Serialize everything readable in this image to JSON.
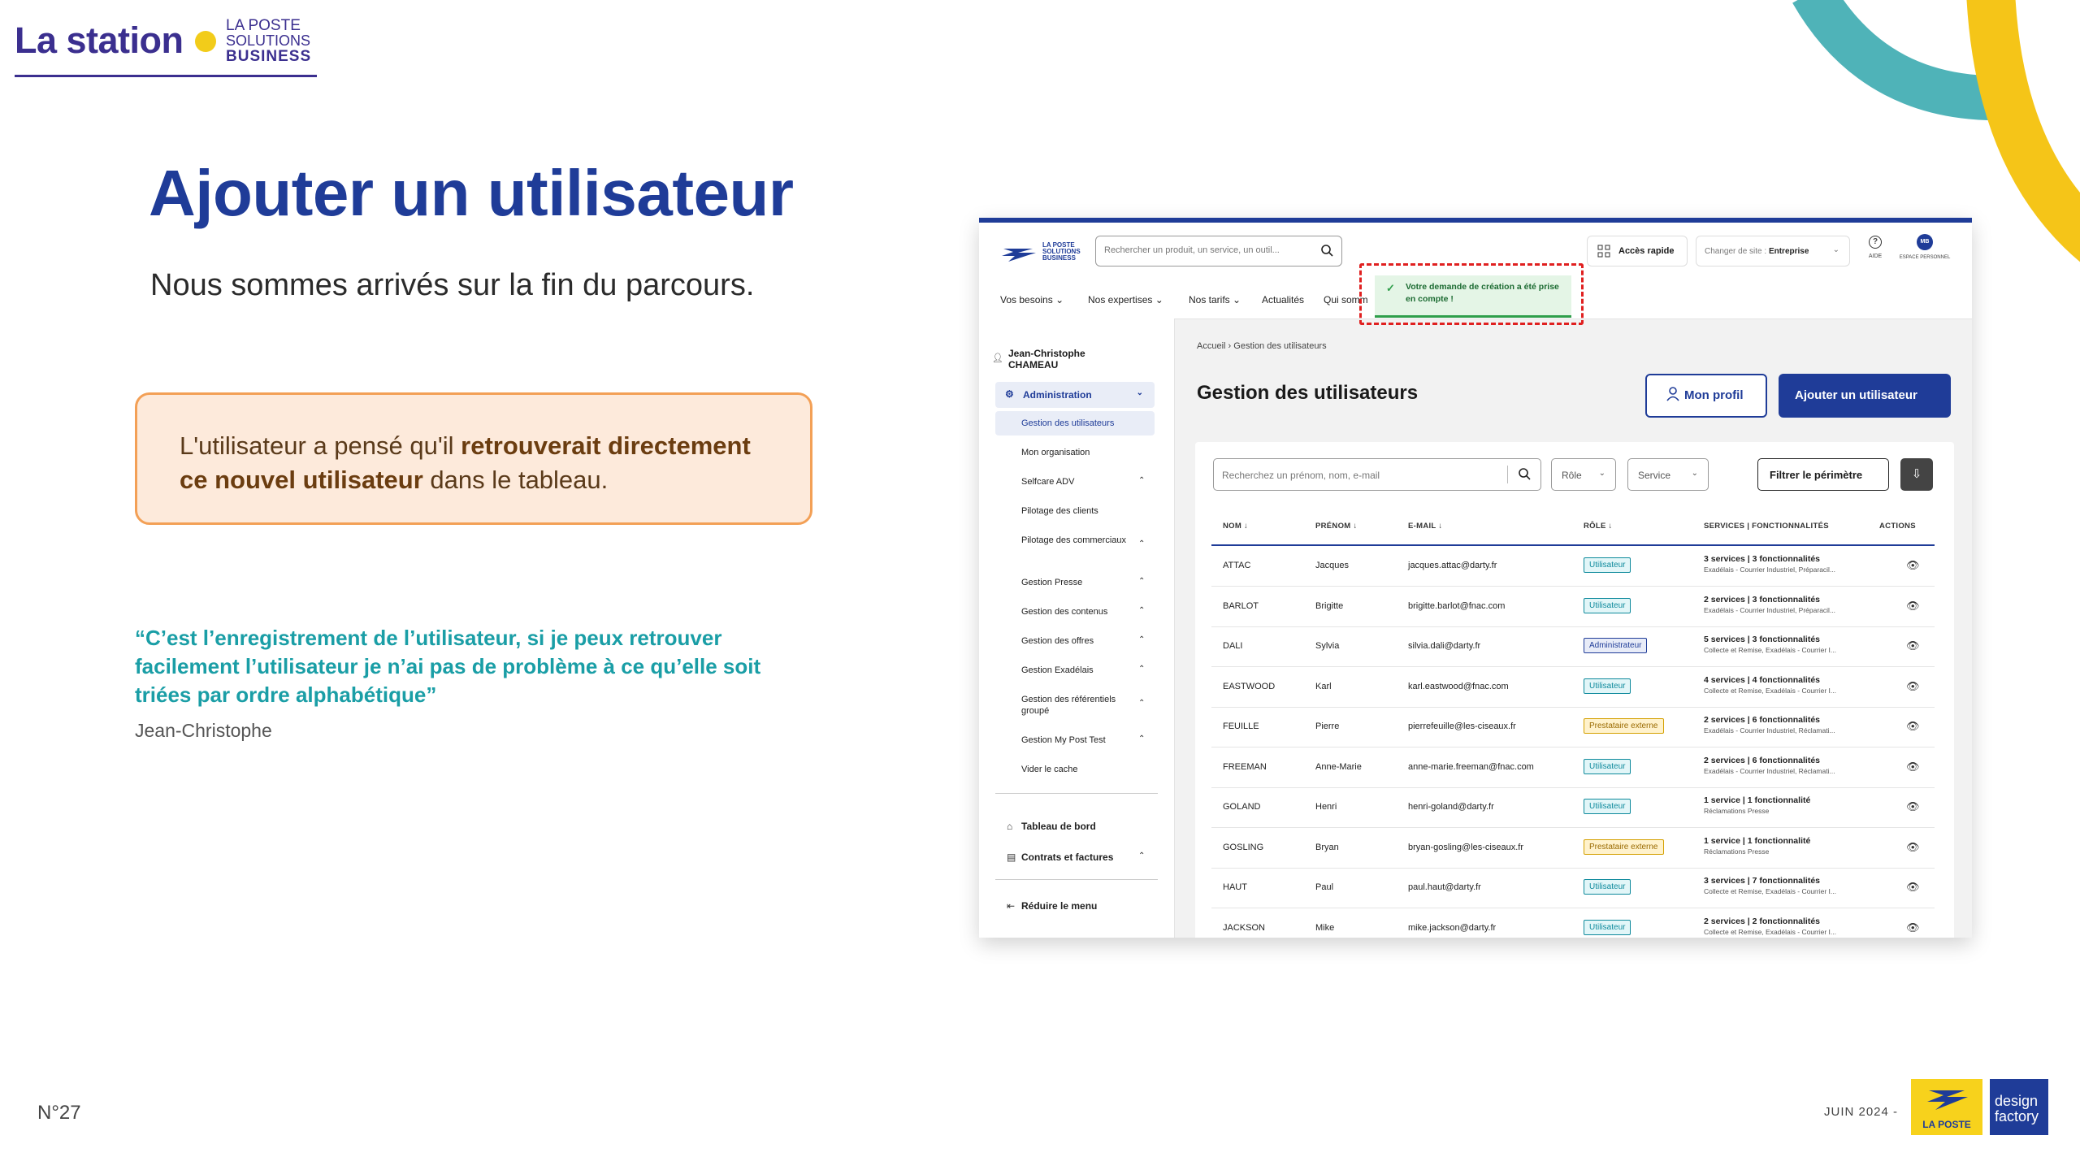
{
  "slide": {
    "brand_name": "La station",
    "brand_sub": [
      "LA POSTE",
      "SOLUTIONS",
      "BUSINESS"
    ],
    "title": "Ajouter un utilisateur",
    "subtitle": "Nous sommes arrivés sur la fin du parcours.",
    "callout": {
      "pre": "L'utilisateur a pensé qu'il ",
      "bold": "retrouverait directement ce nouvel utilisateur",
      "post": " dans le tableau."
    },
    "quote": "“C’est l’enregistrement de l’utilisateur, si je peux retrouver facilement l’utilisateur je n’ai pas de problème à ce qu’elle soit triées par ordre alphabétique”",
    "quote_author": "Jean-Christophe",
    "page_number": "N°27",
    "date": "JUIN 2024 -",
    "logo_laposte": "LA POSTE",
    "logo_df": [
      "design",
      "factory"
    ],
    "colors": {
      "primary": "#1f3c98",
      "accent_yellow": "#f2cc1a",
      "teal": "#1a9ea6",
      "callout_border": "#f3a056"
    }
  },
  "app": {
    "logo_text": [
      "LA POSTE",
      "SOLUTIONS",
      "BUSINESS"
    ],
    "search_placeholder": "Rechercher un produit, un service, un outil...",
    "quick_access": "Accès rapide",
    "site_label": "Changer de site : ",
    "site_value": "Entreprise",
    "help_label": "AIDE",
    "avatar_initials": "MB",
    "profile_label": "ESPACE PERSONNEL",
    "nav": [
      "Vos besoins",
      "Nos expertises",
      "Nos tarifs",
      "Actualités",
      "Qui somm"
    ],
    "toast": "Votre demande de création a été prise en compte !",
    "sidebar": {
      "user": [
        "Jean-Christophe",
        "CHAMEAU"
      ],
      "admin": "Administration",
      "items": [
        "Gestion des utilisateurs",
        "Mon organisation",
        "Selfcare ADV",
        "Pilotage des clients",
        "Pilotage des commerciaux",
        "Gestion Presse",
        "Gestion des contenus",
        "Gestion des offres",
        "Gestion Exadélais",
        "Gestion des référentiels groupé",
        "Gestion My Post Test",
        "Vider le cache"
      ],
      "dashboard": "Tableau de bord",
      "contracts": "Contrats et factures",
      "collapse": "Réduire le menu"
    },
    "breadcrumb": [
      "Accueil",
      "Gestion des utilisateurs"
    ],
    "page_title": "Gestion des utilisateurs",
    "btn_profile": "Mon profil",
    "btn_add": "Ajouter un utilisateur",
    "table_search_placeholder": "Recherchez un prénom, nom, e-mail",
    "filter_role": "Rôle",
    "filter_service": "Service",
    "filter_scope": "Filtrer le périmètre",
    "columns": [
      "NOM",
      "PRÉNOM",
      "E-MAIL",
      "RÔLE",
      "SERVICES | FONCTIONNALITÉS",
      "ACTIONS"
    ],
    "rows": [
      {
        "nom": "ATTAC",
        "prenom": "Jacques",
        "email": "jacques.attac@darty.fr",
        "role": "Utilisateur",
        "role_type": "user",
        "services": "3 services | 3 fonctionnalités",
        "detail": "Exadélais - Courrier Industriel, Préparacil..."
      },
      {
        "nom": "BARLOT",
        "prenom": "Brigitte",
        "email": "brigitte.barlot@fnac.com",
        "role": "Utilisateur",
        "role_type": "user",
        "services": "2 services | 3 fonctionnalités",
        "detail": "Exadélais - Courrier Industriel, Préparacil..."
      },
      {
        "nom": "DALI",
        "prenom": "Sylvia",
        "email": "silvia.dali@darty.fr",
        "role": "Administrateur",
        "role_type": "admin",
        "services": "5 services | 3 fonctionnalités",
        "detail": "Collecte et Remise, Exadélais - Courrier I..."
      },
      {
        "nom": "EASTWOOD",
        "prenom": "Karl",
        "email": "karl.eastwood@fnac.com",
        "role": "Utilisateur",
        "role_type": "user",
        "services": "4 services | 4 fonctionnalités",
        "detail": "Collecte et Remise, Exadélais - Courrier I..."
      },
      {
        "nom": "FEUILLE",
        "prenom": "Pierre",
        "email": "pierrefeuille@les-ciseaux.fr",
        "role": "Prestataire externe",
        "role_type": "ext",
        "services": "2 services | 6 fonctionnalités",
        "detail": "Exadélais - Courrier Industriel, Réclamati..."
      },
      {
        "nom": "FREEMAN",
        "prenom": "Anne-Marie",
        "email": "anne-marie.freeman@fnac.com",
        "role": "Utilisateur",
        "role_type": "user",
        "services": "2 services | 6 fonctionnalités",
        "detail": "Exadélais - Courrier Industriel, Réclamati..."
      },
      {
        "nom": "GOLAND",
        "prenom": "Henri",
        "email": "henri-goland@darty.fr",
        "role": "Utilisateur",
        "role_type": "user",
        "services": "1 service | 1 fonctionnalité",
        "detail": "Réclamations Presse"
      },
      {
        "nom": "GOSLING",
        "prenom": "Bryan",
        "email": "bryan-gosling@les-ciseaux.fr",
        "role": "Prestataire externe",
        "role_type": "ext",
        "services": "1 service | 1 fonctionnalité",
        "detail": "Réclamations Presse"
      },
      {
        "nom": "HAUT",
        "prenom": "Paul",
        "email": "paul.haut@darty.fr",
        "role": "Utilisateur",
        "role_type": "user",
        "services": "3 services | 7 fonctionnalités",
        "detail": "Collecte et Remise, Exadélais - Courrier I..."
      },
      {
        "nom": "JACKSON",
        "prenom": "Mike",
        "email": "mike.jackson@darty.fr",
        "role": "Utilisateur",
        "role_type": "user",
        "services": "2 services | 2 fonctionnalités",
        "detail": "Collecte et Remise, Exadélais - Courrier I..."
      }
    ]
  }
}
